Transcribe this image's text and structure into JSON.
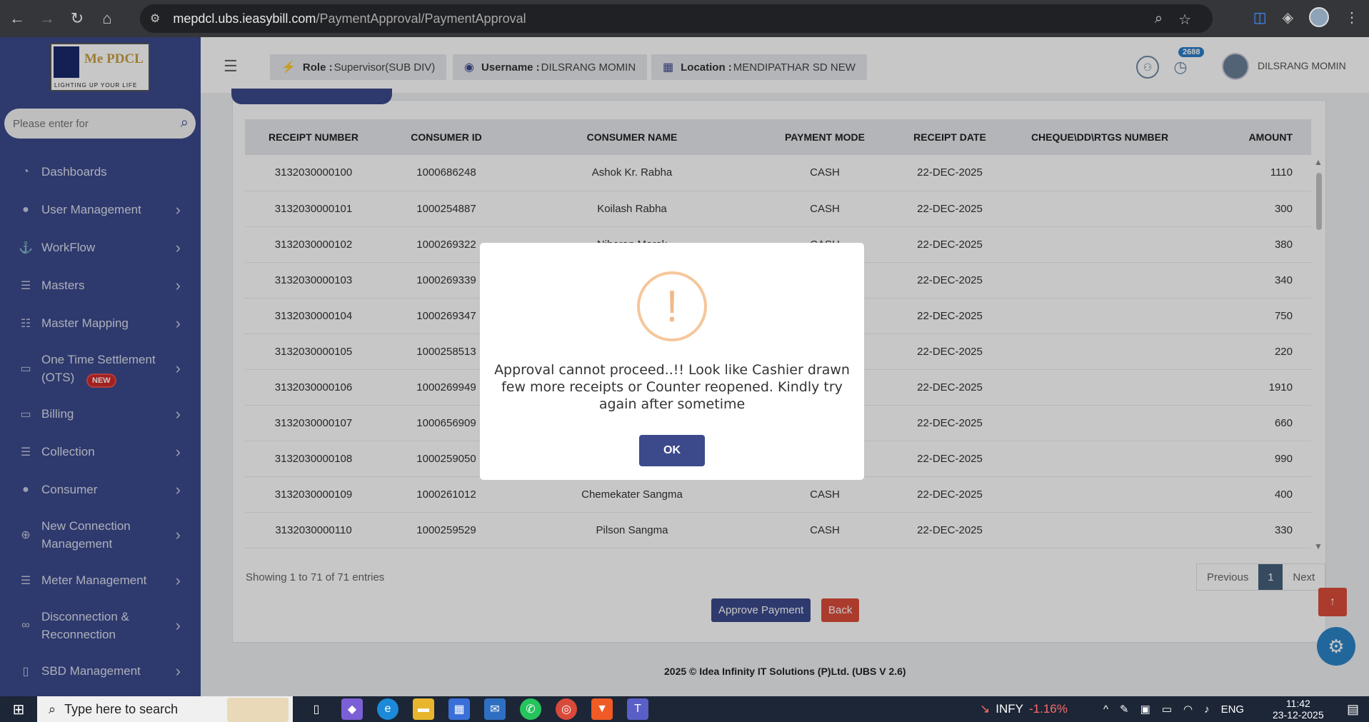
{
  "browser": {
    "url_host": "mepdcl.ubs.ieasybill.com",
    "url_path": "/PaymentApproval/PaymentApproval"
  },
  "logo": {
    "title": "Me PDCL",
    "tagline": "LIGHTING UP YOUR LIFE"
  },
  "sidebar": {
    "search_placeholder": "Please enter for",
    "items": [
      {
        "label": "Dashboards",
        "icon": "gauge-icon",
        "glyph": "◔",
        "has_children": false
      },
      {
        "label": "User Management",
        "icon": "user-icon",
        "glyph": "●",
        "has_children": true
      },
      {
        "label": "WorkFlow",
        "icon": "anchor-icon",
        "glyph": "⚓",
        "has_children": true
      },
      {
        "label": "Masters",
        "icon": "server-icon",
        "glyph": "☰",
        "has_children": true
      },
      {
        "label": "Master Mapping",
        "icon": "sitemap-icon",
        "glyph": "☷",
        "has_children": true
      },
      {
        "label": "One Time Settlement (OTS)",
        "icon": "monitor-icon",
        "glyph": "▭",
        "has_children": true,
        "badge": "NEW"
      },
      {
        "label": "Billing",
        "icon": "monitor-icon",
        "glyph": "▭",
        "has_children": true
      },
      {
        "label": "Collection",
        "icon": "list-icon",
        "glyph": "☰",
        "has_children": true
      },
      {
        "label": "Consumer",
        "icon": "user-icon",
        "glyph": "●",
        "has_children": true
      },
      {
        "label": "New Connection Management",
        "icon": "plus-circle-icon",
        "glyph": "⊕",
        "has_children": true
      },
      {
        "label": "Meter Management",
        "icon": "list-icon",
        "glyph": "☰",
        "has_children": true
      },
      {
        "label": "Disconnection & Reconnection",
        "icon": "link-icon",
        "glyph": "∞",
        "has_children": true
      },
      {
        "label": "SBD Management",
        "icon": "mobile-icon",
        "glyph": "▯",
        "has_children": true
      }
    ]
  },
  "header": {
    "role_label": "Role :",
    "role_value": "Supervisor(SUB DIV)",
    "username_label": "Username :",
    "username_value": "DILSRANG MOMIN",
    "location_label": "Location :",
    "location_value": "MENDIPATHAR SD NEW",
    "notification_count": "2688",
    "user_name": "DILSRANG MOMIN"
  },
  "table": {
    "columns": [
      "RECEIPT NUMBER",
      "CONSUMER ID",
      "CONSUMER NAME",
      "PAYMENT MODE",
      "RECEIPT DATE",
      "CHEQUE\\DD\\RTGS NUMBER",
      "AMOUNT"
    ],
    "rows": [
      [
        "3132030000100",
        "1000686248",
        "Ashok Kr. Rabha",
        "CASH",
        "22-DEC-2025",
        "",
        "1110"
      ],
      [
        "3132030000101",
        "1000254887",
        "Koilash Rabha",
        "CASH",
        "22-DEC-2025",
        "",
        "300"
      ],
      [
        "3132030000102",
        "1000269322",
        "Niharon Marak",
        "CASH",
        "22-DEC-2025",
        "",
        "380"
      ],
      [
        "3132030000103",
        "1000269339",
        "",
        "",
        "22-DEC-2025",
        "",
        "340"
      ],
      [
        "3132030000104",
        "1000269347",
        "",
        "",
        "22-DEC-2025",
        "",
        "750"
      ],
      [
        "3132030000105",
        "1000258513",
        "",
        "",
        "22-DEC-2025",
        "",
        "220"
      ],
      [
        "3132030000106",
        "1000269949",
        "",
        "",
        "22-DEC-2025",
        "",
        "1910"
      ],
      [
        "3132030000107",
        "1000656909",
        "",
        "",
        "22-DEC-2025",
        "",
        "660"
      ],
      [
        "3132030000108",
        "1000259050",
        "",
        "",
        "22-DEC-2025",
        "",
        "990"
      ],
      [
        "3132030000109",
        "1000261012",
        "Chemekater Sangma",
        "CASH",
        "22-DEC-2025",
        "",
        "400"
      ],
      [
        "3132030000110",
        "1000259529",
        "Pilson Sangma",
        "CASH",
        "22-DEC-2025",
        "",
        "330"
      ]
    ],
    "showing": "Showing 1 to 71 of 71 entries",
    "pager": {
      "previous": "Previous",
      "current": "1",
      "next": "Next"
    }
  },
  "actions": {
    "approve": "Approve Payment",
    "back": "Back"
  },
  "footer": "2025 © Idea Infinity IT Solutions (P)Ltd. (UBS V 2.6)",
  "modal": {
    "icon": "!",
    "message": "Approval cannot proceed..!! Look like Cashier drawn few more receipts or Counter reopened. Kindly try again after sometime",
    "ok": "OK"
  },
  "taskbar": {
    "search_placeholder": "Type here to search",
    "stock_symbol": "INFY",
    "stock_change": "-1.16%",
    "language": "ENG",
    "time": "11:42",
    "date": "23-12-2025"
  }
}
